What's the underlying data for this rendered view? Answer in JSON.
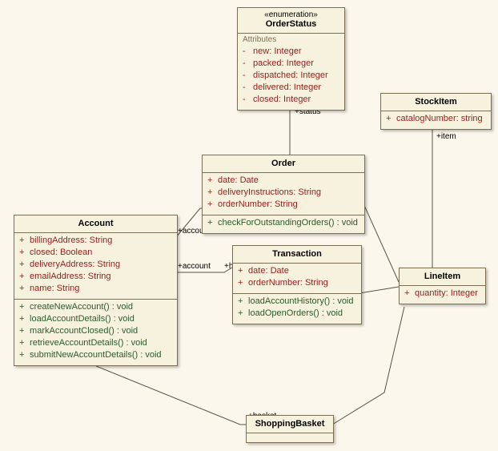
{
  "classes": {
    "orderStatus": {
      "stereotype": "«enumeration»",
      "name": "OrderStatus",
      "sectionLabel": "Attributes",
      "attrs": [
        {
          "vis": "-",
          "text": "new: Integer"
        },
        {
          "vis": "-",
          "text": "packed: Integer"
        },
        {
          "vis": "-",
          "text": "dispatched: Integer"
        },
        {
          "vis": "-",
          "text": "delivered: Integer"
        },
        {
          "vis": "-",
          "text": "closed: Integer"
        }
      ]
    },
    "stockItem": {
      "name": "StockItem",
      "attrs": [
        {
          "vis": "+",
          "text": "catalogNumber: string"
        }
      ]
    },
    "order": {
      "name": "Order",
      "attrs": [
        {
          "vis": "+",
          "text": "date: Date"
        },
        {
          "vis": "+",
          "text": "deliveryInstructions: String"
        },
        {
          "vis": "+",
          "text": "orderNumber: String"
        }
      ],
      "ops": [
        {
          "vis": "+",
          "text": "checkForOutstandingOrders() : void"
        }
      ]
    },
    "account": {
      "name": "Account",
      "attrs": [
        {
          "vis": "+",
          "text": "billingAddress: String"
        },
        {
          "vis": "+",
          "text": "closed: Boolean"
        },
        {
          "vis": "+",
          "text": "deliveryAddress: String"
        },
        {
          "vis": "+",
          "text": "emailAddress: String"
        },
        {
          "vis": "+",
          "text": "name: String"
        }
      ],
      "ops": [
        {
          "vis": "+",
          "text": "createNewAccount() : void"
        },
        {
          "vis": "+",
          "text": "loadAccountDetails() : void"
        },
        {
          "vis": "+",
          "text": "markAccountClosed() : void"
        },
        {
          "vis": "+",
          "text": "retrieveAccountDetails() : void"
        },
        {
          "vis": "+",
          "text": "submitNewAccountDetails() : void"
        }
      ]
    },
    "transaction": {
      "name": "Transaction",
      "attrs": [
        {
          "vis": "+",
          "text": "date: Date"
        },
        {
          "vis": "+",
          "text": "orderNumber: String"
        }
      ],
      "ops": [
        {
          "vis": "+",
          "text": "loadAccountHistory() : void"
        },
        {
          "vis": "+",
          "text": "loadOpenOrders() : void"
        }
      ]
    },
    "lineItem": {
      "name": "LineItem",
      "attrs": [
        {
          "vis": "+",
          "text": "quantity: Integer"
        }
      ]
    },
    "shoppingBasket": {
      "name": "ShoppingBasket"
    }
  },
  "roles": {
    "status": "+status",
    "item": "+item",
    "account1": "+account",
    "account2": "+account",
    "history": "+history",
    "basket": "+basket"
  }
}
